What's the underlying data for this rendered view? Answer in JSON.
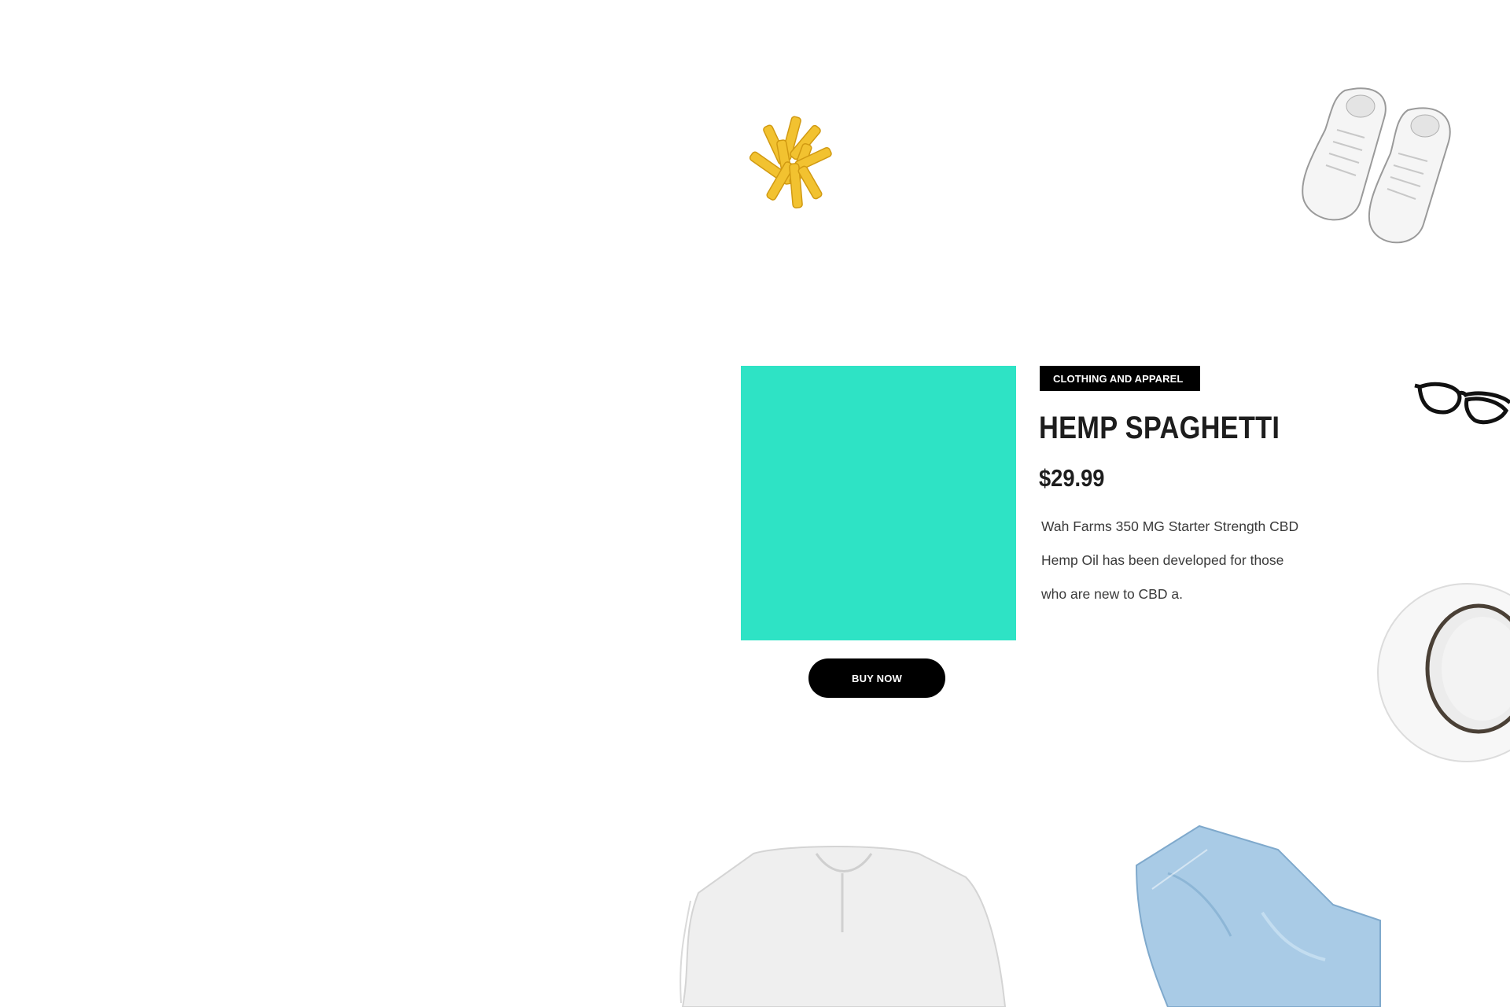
{
  "product": {
    "category": "CLOTHING AND APPAREL",
    "title": "HEMP SPAGHETTI",
    "price": "$29.99",
    "description": "Wah Farms 350 MG Starter Strength CBD Hemp Oil has been developed for those who are new to CBD a.",
    "buy_label": "BUY NOW",
    "image_color": "#2ee3c5"
  },
  "decorations": [
    "pasta",
    "sneakers",
    "glasses",
    "hat",
    "blouse",
    "jeans"
  ]
}
